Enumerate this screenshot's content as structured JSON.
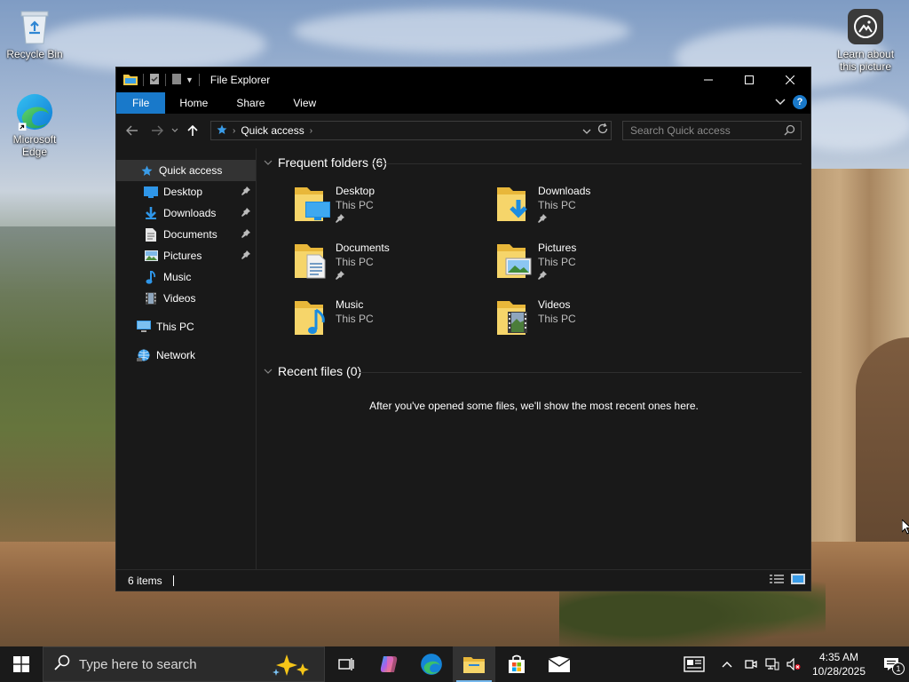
{
  "desktop": {
    "icons": [
      {
        "label": "Recycle Bin"
      },
      {
        "label": "Microsoft Edge"
      },
      {
        "label": "Learn about this picture"
      }
    ]
  },
  "window": {
    "title": "File Explorer",
    "ribbon_tabs": [
      "File",
      "Home",
      "Share",
      "View"
    ],
    "address": {
      "crumb": "Quick access"
    },
    "search_placeholder": "Search Quick access",
    "nav": [
      {
        "label": "Quick access",
        "pinned": false
      },
      {
        "label": "Desktop",
        "pinned": true
      },
      {
        "label": "Downloads",
        "pinned": true
      },
      {
        "label": "Documents",
        "pinned": true
      },
      {
        "label": "Pictures",
        "pinned": true
      },
      {
        "label": "Music",
        "pinned": false
      },
      {
        "label": "Videos",
        "pinned": false
      },
      {
        "label": "This PC",
        "pinned": false
      },
      {
        "label": "Network",
        "pinned": false
      }
    ],
    "frequent_header": "Frequent folders (6)",
    "recent_header": "Recent files (0)",
    "empty_message": "After you've opened some files, we'll show the most recent ones here.",
    "folders": [
      {
        "name": "Desktop",
        "location": "This PC",
        "pinned": true,
        "icon": "desktop-folder-icon"
      },
      {
        "name": "Downloads",
        "location": "This PC",
        "pinned": true,
        "icon": "downloads-folder-icon"
      },
      {
        "name": "Documents",
        "location": "This PC",
        "pinned": true,
        "icon": "documents-folder-icon"
      },
      {
        "name": "Pictures",
        "location": "This PC",
        "pinned": true,
        "icon": "pictures-folder-icon"
      },
      {
        "name": "Music",
        "location": "This PC",
        "pinned": false,
        "icon": "music-folder-icon"
      },
      {
        "name": "Videos",
        "location": "This PC",
        "pinned": false,
        "icon": "videos-folder-icon"
      }
    ],
    "status": "6 items"
  },
  "taskbar": {
    "search_placeholder": "Type here to search",
    "time": "4:35 AM",
    "date": "10/28/2025",
    "notification_count": "1"
  },
  "colors": {
    "accent": "#1979ca",
    "window_bg": "#191919",
    "folder_yellow": "#f0c94a"
  }
}
